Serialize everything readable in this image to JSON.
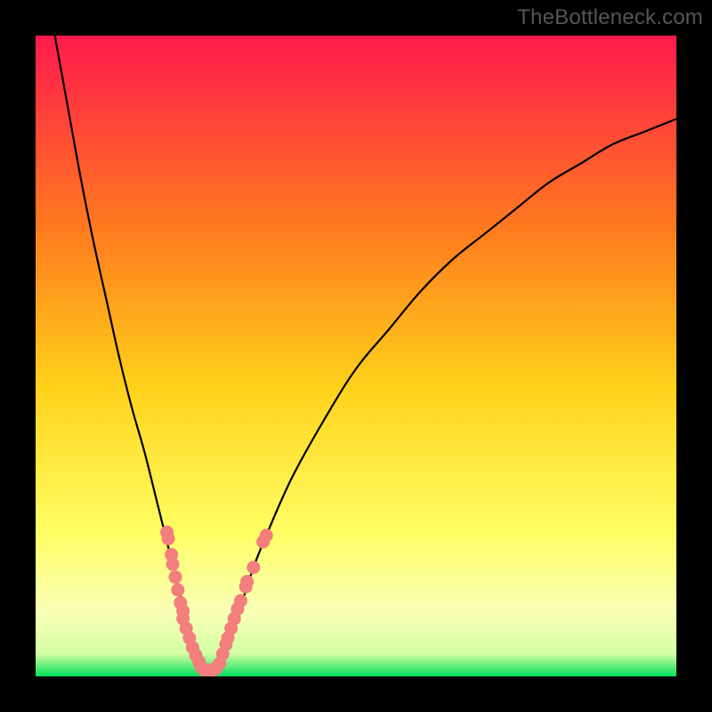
{
  "watermark": "TheBottleneck.com",
  "colors": {
    "frame_bg": "#000000",
    "gradient_top": "#ff1a4d",
    "gradient_mid1": "#ff7a1f",
    "gradient_mid2": "#ffd21a",
    "gradient_mid3": "#ffff66",
    "gradient_pale": "#f9ffb8",
    "gradient_bottom": "#00e05a",
    "curve": "#000000",
    "marker": "#f27e7e"
  },
  "chart_data": {
    "type": "line",
    "xlabel": "",
    "ylabel": "",
    "title": "",
    "xlim": [
      0,
      100
    ],
    "ylim": [
      0,
      100
    ],
    "grid": false,
    "series": [
      {
        "name": "bottleneck-curve-left",
        "x": [
          3,
          5,
          7,
          9,
          11,
          13,
          15,
          17,
          19,
          21,
          22,
          23,
          24,
          25,
          26
        ],
        "values": [
          100,
          89,
          78,
          68,
          59,
          50,
          42,
          35,
          27,
          19,
          15,
          11,
          7,
          4,
          1
        ]
      },
      {
        "name": "bottleneck-curve-right",
        "x": [
          28,
          29,
          30,
          32,
          34,
          36,
          40,
          45,
          50,
          55,
          60,
          65,
          70,
          75,
          80,
          85,
          90,
          95,
          100
        ],
        "values": [
          1,
          3,
          6,
          11,
          17,
          22,
          31,
          40,
          48,
          54,
          60,
          65,
          69,
          73,
          77,
          80,
          83,
          85,
          87
        ]
      }
    ],
    "flat_bottom": {
      "x_start": 26,
      "x_end": 28,
      "y": 1
    },
    "markers": [
      {
        "x": 20.5,
        "y": 22.5
      },
      {
        "x": 20.7,
        "y": 21.5
      },
      {
        "x": 21.2,
        "y": 19.0
      },
      {
        "x": 21.4,
        "y": 17.5
      },
      {
        "x": 21.8,
        "y": 15.5
      },
      {
        "x": 22.2,
        "y": 13.5
      },
      {
        "x": 22.6,
        "y": 11.5
      },
      {
        "x": 23.0,
        "y": 10.2
      },
      {
        "x": 23.0,
        "y": 9.0
      },
      {
        "x": 23.5,
        "y": 7.5
      },
      {
        "x": 24.0,
        "y": 6.0
      },
      {
        "x": 24.5,
        "y": 4.5
      },
      {
        "x": 25.0,
        "y": 3.3
      },
      {
        "x": 25.5,
        "y": 2.3
      },
      {
        "x": 25.8,
        "y": 1.5
      },
      {
        "x": 26.3,
        "y": 1.0
      },
      {
        "x": 27.0,
        "y": 1.0
      },
      {
        "x": 27.7,
        "y": 1.0
      },
      {
        "x": 28.2,
        "y": 1.3
      },
      {
        "x": 28.7,
        "y": 2.0
      },
      {
        "x": 29.2,
        "y": 3.5
      },
      {
        "x": 29.7,
        "y": 5.0
      },
      {
        "x": 30.0,
        "y": 6.0
      },
      {
        "x": 30.5,
        "y": 7.5
      },
      {
        "x": 31.0,
        "y": 9.0
      },
      {
        "x": 31.5,
        "y": 10.5
      },
      {
        "x": 32.0,
        "y": 11.8
      },
      {
        "x": 32.8,
        "y": 14.0
      },
      {
        "x": 33.0,
        "y": 14.8
      },
      {
        "x": 34.0,
        "y": 17.0
      },
      {
        "x": 35.5,
        "y": 21.0
      },
      {
        "x": 36.0,
        "y": 22.0
      }
    ]
  }
}
